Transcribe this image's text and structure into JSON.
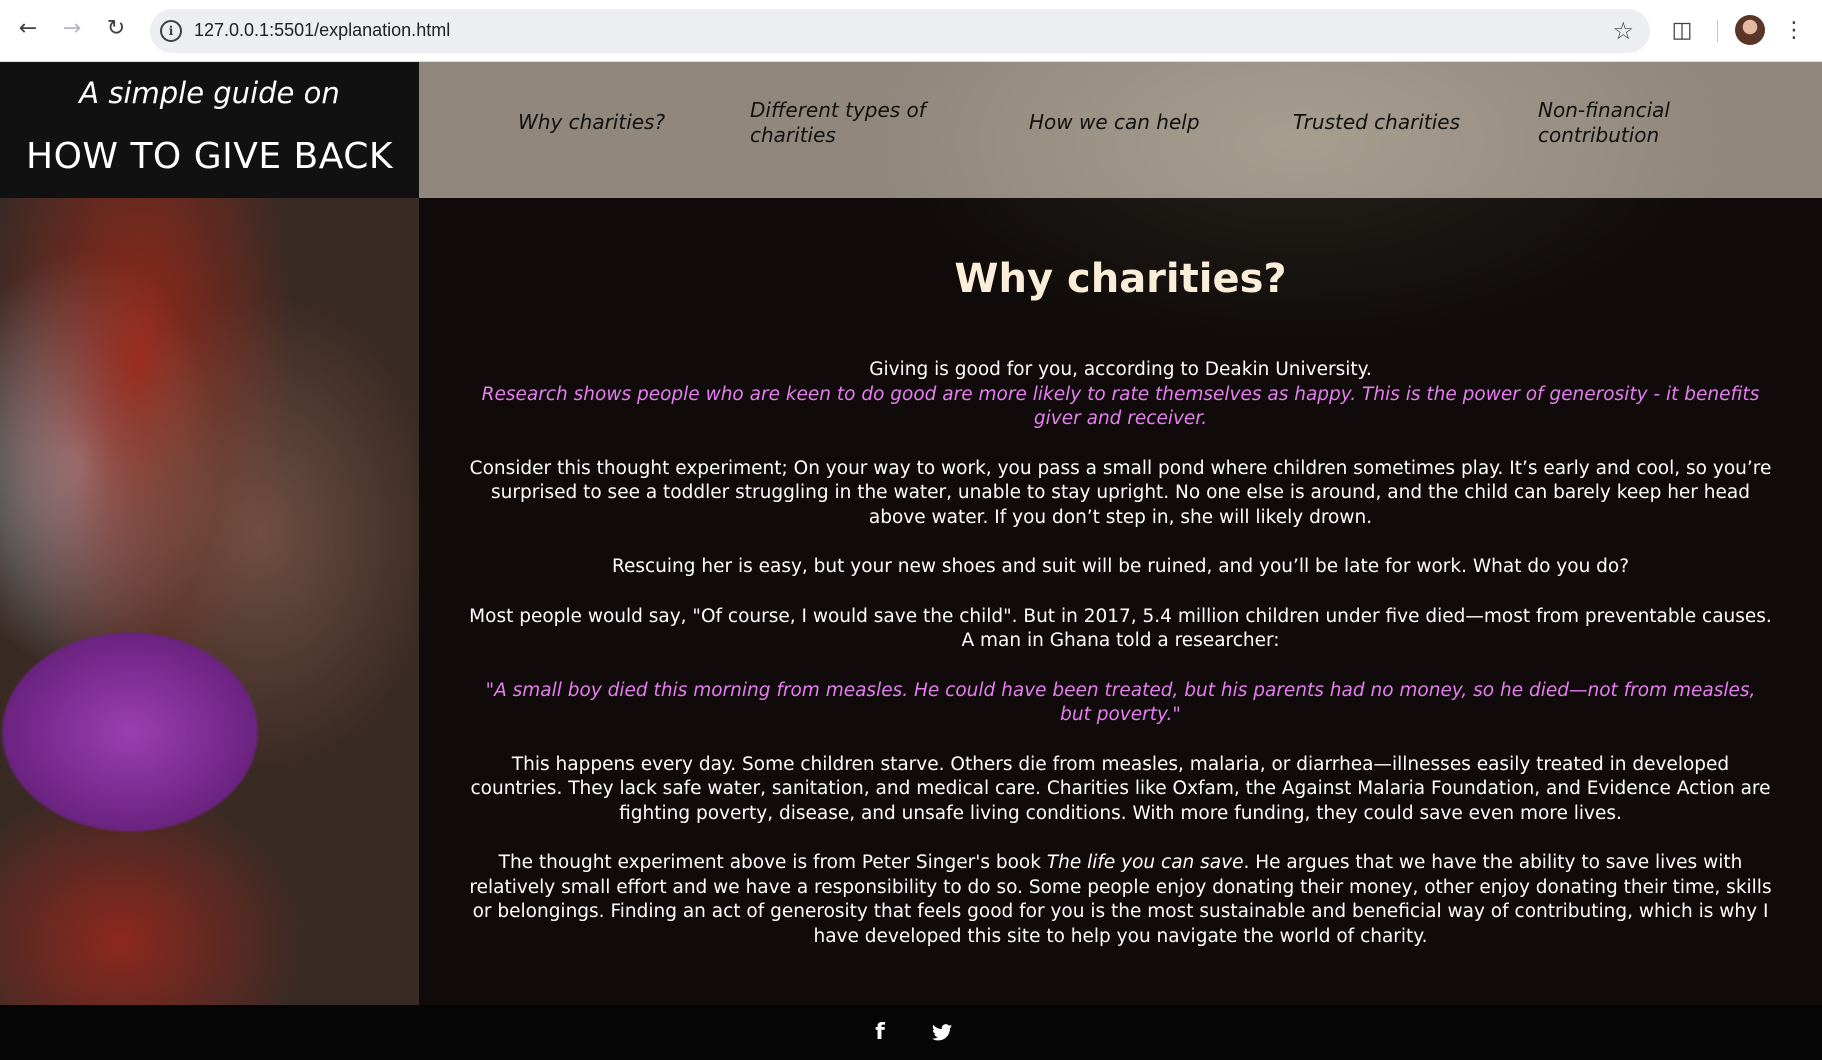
{
  "browser": {
    "url": "127.0.0.1:5501/explanation.html"
  },
  "header": {
    "tagline": "A simple guide on",
    "title": "HOW TO GIVE BACK"
  },
  "nav": {
    "items": [
      {
        "label": "Why charities?"
      },
      {
        "label": "Different types of charities"
      },
      {
        "label": "How we can help"
      },
      {
        "label": "Trusted charities"
      },
      {
        "label": "Non-financial contribution"
      }
    ]
  },
  "main": {
    "heading": "Why charities?",
    "p1_line": "Giving is good for you, according to Deakin University.",
    "p1_quote": "Research shows people who are keen to do good are more likely to rate themselves as happy. This is the power of generosity - it benefits giver and receiver.",
    "p2": "Consider this thought experiment; On your way to work, you pass a small pond where children sometimes play. It’s early and cool, so you’re surprised to see a toddler struggling in the water, unable to stay upright. No one else is around, and the child can barely keep her head above water. If you don’t step in, she will likely drown.",
    "p3": "Rescuing her is easy, but your new shoes and suit will be ruined, and you’ll be late for work. What do you do?",
    "p4": "Most people would say, \"Of course, I would save the child\". But in 2017, 5.4 million children under five died—most from preventable causes. A man in Ghana told a researcher:",
    "quote": "\"A small boy died this morning from measles. He could have been treated, but his parents had no money, so he died—not from measles, but poverty.\"",
    "p5": "This happens every day. Some children starve. Others die from measles, malaria, or diarrhea—illnesses easily treated in developed countries. They lack safe water, sanitation, and medical care. Charities like Oxfam, the Against Malaria Foundation, and Evidence Action are fighting poverty, disease, and unsafe living conditions. With more funding, they could save even more lives.",
    "p6_before": "The thought experiment above is from Peter Singer's book ",
    "p6_book": "The life you can save",
    "p6_after": ". He argues that we have the ability to save lives with relatively small effort and we have a responsibility to do so. Some people enjoy donating their money, other enjoy donating their time, skills or belongings. Finding an act of generosity that feels good for you is the most sustainable and beneficial way of contributing, which is why I have developed this site to help you navigate the world of charity."
  },
  "footer": {
    "icons": [
      "facebook-icon",
      "twitter-icon"
    ]
  },
  "colors": {
    "accent_pink": "#e57ff0",
    "heading": "#fbeed8"
  }
}
